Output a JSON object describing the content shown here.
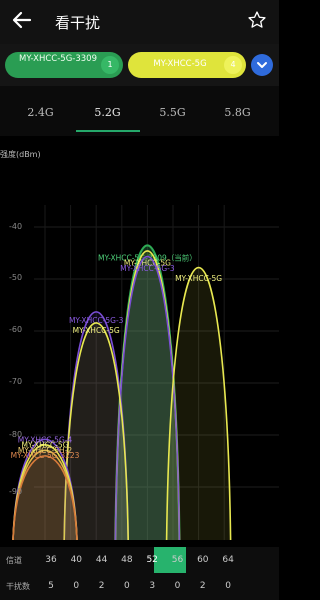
{
  "header": {
    "title": "看干扰"
  },
  "chips": [
    {
      "label": "MY-XHCC-5G-3309",
      "badge": "1",
      "color": "#2a9d53"
    },
    {
      "label": "MY-XHCC-5G",
      "badge": "4",
      "color": "#dfe43b"
    }
  ],
  "tabs": [
    {
      "label": "2.4G",
      "active": false
    },
    {
      "label": "5.2G",
      "active": true
    },
    {
      "label": "5.5G",
      "active": false
    },
    {
      "label": "5.8G",
      "active": false
    }
  ],
  "chart_data": {
    "type": "area",
    "ylabel": "强度(dBm)",
    "yticks": [
      "-40",
      "-50",
      "-60",
      "-70",
      "-80",
      "-90"
    ],
    "ylim": [
      -100,
      -35
    ],
    "x_channels": [
      36,
      40,
      44,
      48,
      52,
      56,
      60,
      64
    ],
    "series": [
      {
        "name": "MY-XHCC-5G-3309（当前）",
        "center": 52,
        "width": 8,
        "peak": -47,
        "color": "#2faa55",
        "labelColor": "#4fd27a"
      },
      {
        "name": "MY-XHCC-5G",
        "center": 52,
        "width": 8,
        "peak": -48,
        "color": "#e8e850",
        "labelColor": "#f2f280"
      },
      {
        "name": "MY-XHCC-5G-3",
        "center": 52,
        "width": 8,
        "peak": -49,
        "color": "#7a4ed6",
        "labelColor": "#8a5ae0"
      },
      {
        "name": "MY-XHCC-5G",
        "center": 60,
        "width": 8,
        "peak": -51,
        "color": "#e8e850",
        "labelColor": "#f2f280"
      },
      {
        "name": "MY-XHCC-5G-3",
        "center": 44,
        "width": 8,
        "peak": -59,
        "color": "#7a4ed6",
        "labelColor": "#8a5ae0"
      },
      {
        "name": "MY-XHCC-5G",
        "center": 44,
        "width": 8,
        "peak": -61,
        "color": "#e8e850",
        "labelColor": "#f2f280"
      },
      {
        "name": "MY-XHCC-5G-4",
        "center": 36,
        "width": 8,
        "peak": -82,
        "color": "#7a4ed6",
        "labelColor": "#9b6ae6"
      },
      {
        "name": "MY-XHCC-5G",
        "center": 36,
        "width": 8,
        "peak": -83,
        "color": "#e8e850",
        "labelColor": "#f2f280"
      },
      {
        "name": "MY-XHCC-5H-2",
        "center": 36,
        "width": 8,
        "peak": -84,
        "color": "#e0b84a",
        "labelColor": "#f0d070"
      },
      {
        "name": "MY-XHCC-5G-3223",
        "center": 36,
        "width": 8,
        "peak": -85,
        "color": "#d67a3a",
        "labelColor": "#e08a50"
      }
    ]
  },
  "footer": {
    "channel_label": "信道",
    "count_label": "干扰数",
    "channels": [
      "36",
      "40",
      "44",
      "48",
      "52",
      "56",
      "60",
      "64"
    ],
    "counts": [
      "5",
      "0",
      "2",
      "0",
      "3",
      "0",
      "2",
      "0"
    ],
    "selected": "52"
  }
}
